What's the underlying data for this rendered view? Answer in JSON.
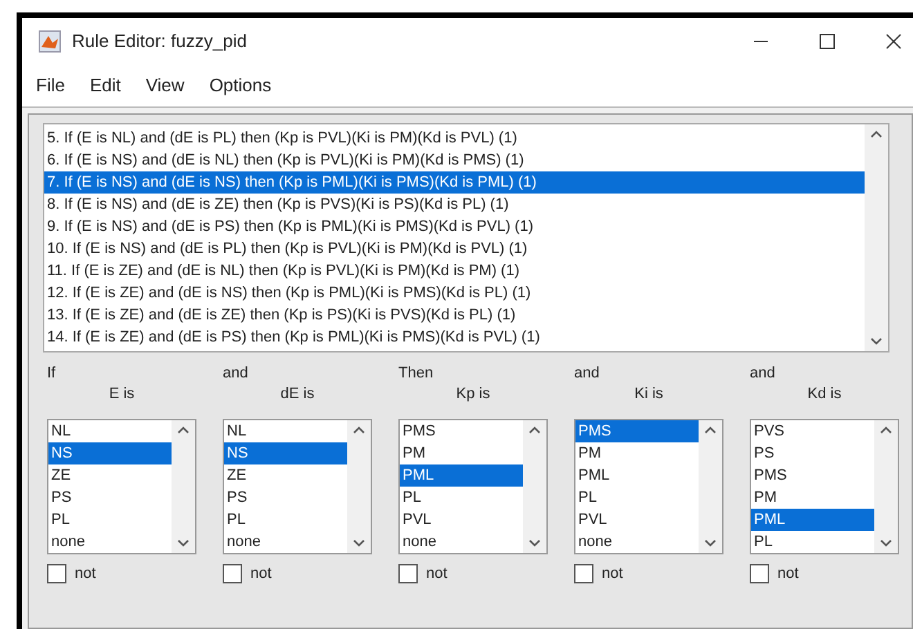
{
  "window": {
    "title": "Rule Editor: fuzzy_pid"
  },
  "menu": [
    "File",
    "Edit",
    "View",
    "Options"
  ],
  "rules": [
    {
      "text": "5. If (E is NL) and (dE is PL) then (Kp is PVL)(Ki is PM)(Kd is PVL) (1)",
      "selected": false
    },
    {
      "text": "6. If (E is NS) and (dE is NL) then (Kp is PVL)(Ki is PM)(Kd is PMS) (1)",
      "selected": false
    },
    {
      "text": "7. If (E is NS) and (dE is NS) then (Kp is PML)(Ki is PMS)(Kd is PML) (1)",
      "selected": true
    },
    {
      "text": "8. If (E is NS) and (dE is ZE) then (Kp is PVS)(Ki is PS)(Kd is PL) (1)",
      "selected": false
    },
    {
      "text": "9. If (E is NS) and (dE is PS) then (Kp is PML)(Ki is PMS)(Kd is PVL) (1)",
      "selected": false
    },
    {
      "text": "10. If (E is NS) and (dE is PL) then (Kp is PVL)(Ki is PM)(Kd is PVL) (1)",
      "selected": false
    },
    {
      "text": "11. If (E is ZE) and (dE is NL) then (Kp is PVL)(Ki is PM)(Kd is PM) (1)",
      "selected": false
    },
    {
      "text": "12. If (E is ZE) and (dE is NS) then (Kp is PML)(Ki is PMS)(Kd is PL) (1)",
      "selected": false
    },
    {
      "text": "13. If (E is ZE) and (dE is ZE) then (Kp is PS)(Ki is PVS)(Kd is PL) (1)",
      "selected": false
    },
    {
      "text": "14. If (E is ZE) and (dE is PS) then (Kp is PML)(Ki is PMS)(Kd is PVL) (1)",
      "selected": false
    }
  ],
  "variables": [
    {
      "connector": "If",
      "label": "E is",
      "not": false,
      "items": [
        {
          "text": "NL",
          "selected": false
        },
        {
          "text": "NS",
          "selected": true
        },
        {
          "text": "ZE",
          "selected": false
        },
        {
          "text": "PS",
          "selected": false
        },
        {
          "text": "PL",
          "selected": false
        },
        {
          "text": "none",
          "selected": false
        }
      ],
      "not_label": "not"
    },
    {
      "connector": "and",
      "label": "dE is",
      "not": false,
      "items": [
        {
          "text": "NL",
          "selected": false
        },
        {
          "text": "NS",
          "selected": true
        },
        {
          "text": "ZE",
          "selected": false
        },
        {
          "text": "PS",
          "selected": false
        },
        {
          "text": "PL",
          "selected": false
        },
        {
          "text": "none",
          "selected": false
        }
      ],
      "not_label": "not"
    },
    {
      "connector": "Then",
      "label": "Kp is",
      "not": false,
      "items": [
        {
          "text": "PMS",
          "selected": false
        },
        {
          "text": "PM",
          "selected": false
        },
        {
          "text": "PML",
          "selected": true
        },
        {
          "text": "PL",
          "selected": false
        },
        {
          "text": "PVL",
          "selected": false
        },
        {
          "text": "none",
          "selected": false
        }
      ],
      "not_label": "not"
    },
    {
      "connector": "and",
      "label": "Ki is",
      "not": false,
      "items": [
        {
          "text": "PMS",
          "selected": true
        },
        {
          "text": "PM",
          "selected": false
        },
        {
          "text": "PML",
          "selected": false
        },
        {
          "text": "PL",
          "selected": false
        },
        {
          "text": "PVL",
          "selected": false
        },
        {
          "text": "none",
          "selected": false
        }
      ],
      "not_label": "not"
    },
    {
      "connector": "and",
      "label": "Kd is",
      "not": false,
      "items": [
        {
          "text": "PVS",
          "selected": false
        },
        {
          "text": "PS",
          "selected": false
        },
        {
          "text": "PMS",
          "selected": false
        },
        {
          "text": "PM",
          "selected": false
        },
        {
          "text": "PML",
          "selected": true
        },
        {
          "text": "PL",
          "selected": false
        }
      ],
      "not_label": "not"
    }
  ]
}
